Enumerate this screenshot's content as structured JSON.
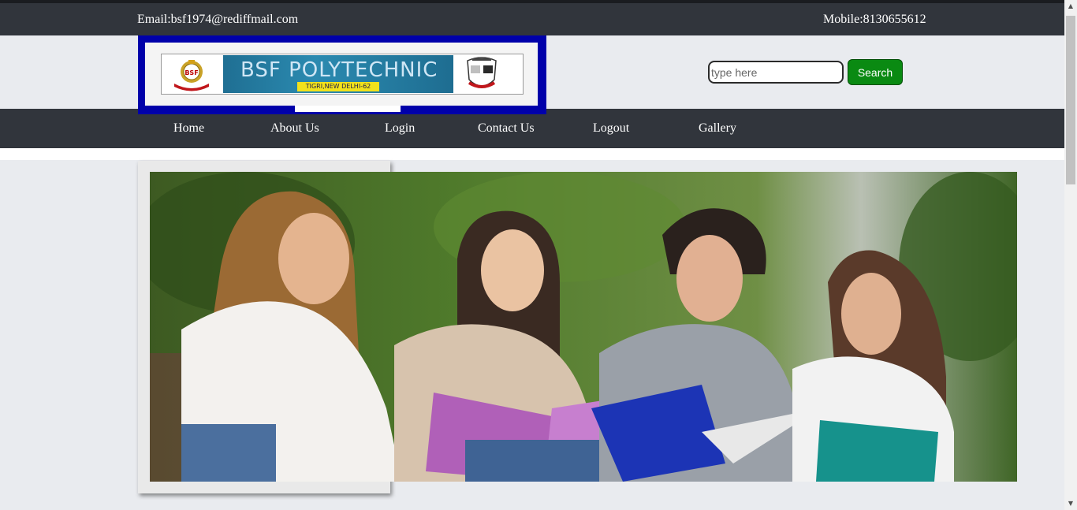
{
  "contact": {
    "email": "Email:bsf1974@rediffmail.com",
    "mobile": "Mobile:8130655612"
  },
  "logo": {
    "title": "BSF POLYTECHNIC",
    "subtitle": "TIGRI,NEW DELHI-62",
    "left_emblem_text": "BSF"
  },
  "search": {
    "placeholder": "type here",
    "value": "",
    "button_label": "Search"
  },
  "nav": {
    "items": [
      {
        "label": "Home"
      },
      {
        "label": "About Us"
      },
      {
        "label": "Login"
      },
      {
        "label": "Contact Us"
      },
      {
        "label": "Logout"
      },
      {
        "label": "Gallery"
      }
    ]
  },
  "banner": {
    "image_subject": "four-smiling-students-with-notebooks"
  },
  "scrollbar": {
    "up_arrow": "▲",
    "down_arrow": "▼"
  },
  "colors": {
    "bar_dark": "#31353c",
    "page_bg": "#e9ebef",
    "logo_border": "#0000aa",
    "search_button": "#0a8a12"
  }
}
